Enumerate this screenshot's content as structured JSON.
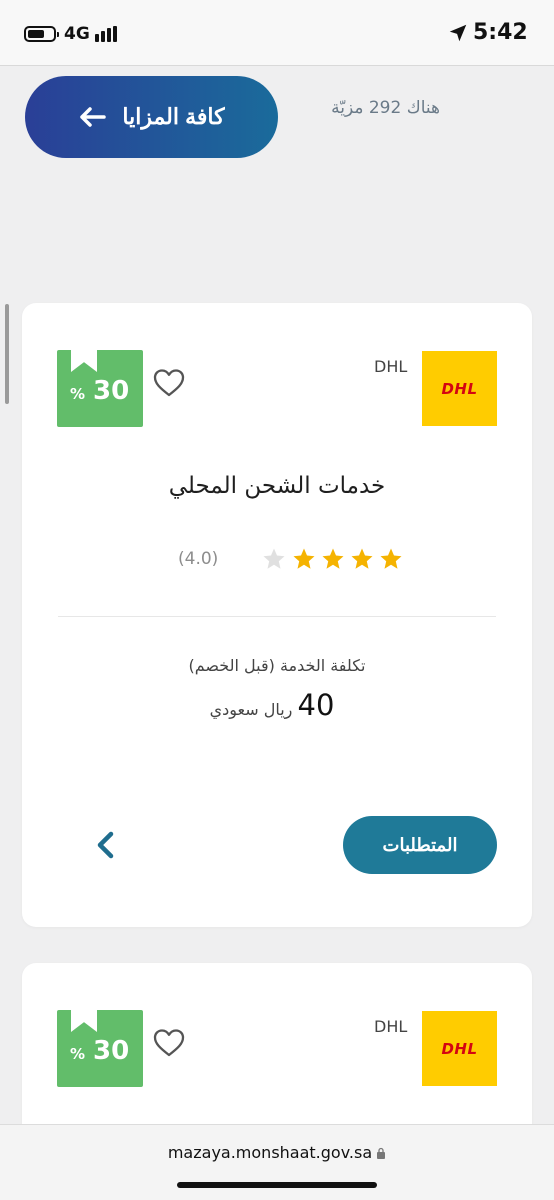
{
  "status_bar": {
    "network": "4G",
    "time": "5:42",
    "icons": [
      "battery-icon",
      "signal-icon",
      "location-arrow-icon"
    ]
  },
  "header": {
    "all_benefits_label": "كافة المزايا",
    "benefits_count": "هناك 292 مزيّة"
  },
  "cards": [
    {
      "provider": "DHL",
      "logo_text": "DHL",
      "discount_value": "30",
      "discount_symbol": "%",
      "title": "خدمات الشحن المحلي",
      "rating": 4.0,
      "rating_text": "(4.0)",
      "cost_label": "تكلفة الخدمة (قبل الخصم)",
      "cost_value": "40",
      "cost_currency": "ريال سعودي",
      "requirements_label": "المتطلبات"
    },
    {
      "provider": "DHL",
      "logo_text": "DHL",
      "discount_value": "30",
      "discount_symbol": "%"
    }
  ],
  "address_bar": {
    "url": "mazaya.monshaat.gov.sa"
  },
  "colors": {
    "button_gradient_start": "#2a3f97",
    "button_gradient_end": "#1a6b9b",
    "requirements_button": "#1f7a98",
    "discount_badge": "#62bd6a",
    "star_filled": "#f5b301",
    "star_empty": "#e0e0e0",
    "dhl_yellow": "#ffcc00",
    "dhl_red": "#d40511"
  }
}
